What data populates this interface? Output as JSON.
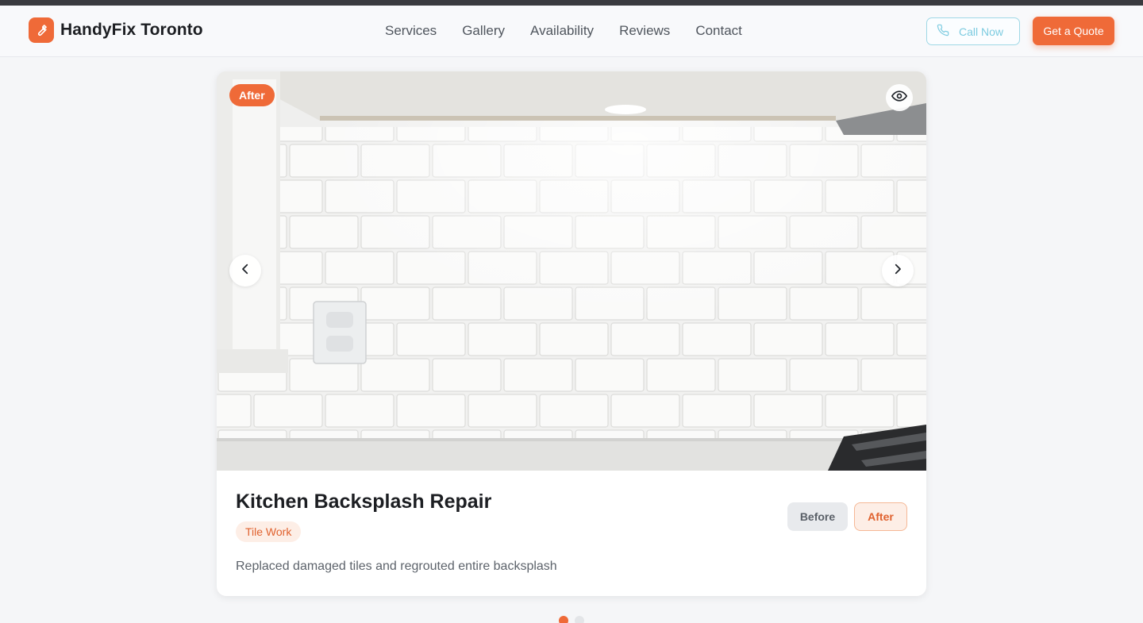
{
  "header": {
    "brand": "HandyFix Toronto",
    "nav": [
      "Services",
      "Gallery",
      "Availability",
      "Reviews",
      "Contact"
    ],
    "call_label": "Call Now",
    "quote_label": "Get a Quote"
  },
  "gallery": {
    "image_badge": "After",
    "project_title": "Kitchen Backsplash Repair",
    "category": "Tile Work",
    "description": "Replaced damaged tiles and regrouted entire backsplash",
    "toggle": {
      "before_label": "Before",
      "after_label": "After",
      "selected": "After"
    },
    "slide_count": 2,
    "active_slide": 1
  },
  "colors": {
    "accent": "#ef6a38",
    "call_outline": "#9fd8e6",
    "page_bg": "#f5f6f8"
  },
  "icons": {
    "logo": "wrench-icon",
    "call": "phone-icon",
    "view": "eye-icon",
    "prev": "chevron-left-icon",
    "next": "chevron-right-icon"
  }
}
